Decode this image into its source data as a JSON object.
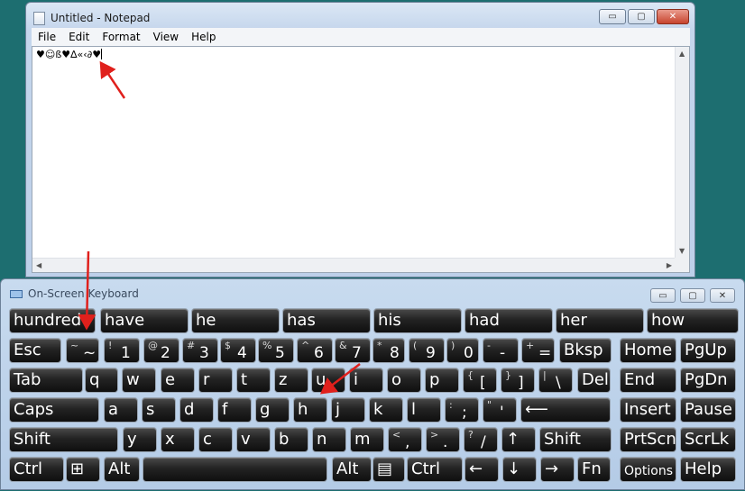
{
  "notepad": {
    "title": "Untitled - Notepad",
    "controls": {
      "minimize": "▭",
      "maximize": "▢",
      "close": "✕"
    },
    "menu": [
      "File",
      "Edit",
      "Format",
      "View",
      "Help"
    ],
    "content": "♥☺ß♥∆«‹∂♥"
  },
  "osk": {
    "title": "On-Screen Keyboard",
    "controls": {
      "minimize": "▭",
      "maximize": "▢",
      "close": "✕"
    },
    "predictions": [
      "hundred",
      "have",
      "he",
      "has",
      "his",
      "had",
      "her",
      "how"
    ],
    "rows": {
      "r1": [
        {
          "main": "Esc"
        },
        {
          "shift": "~",
          "base": "~"
        },
        {
          "shift": "!",
          "base": "1"
        },
        {
          "shift": "@",
          "base": "2"
        },
        {
          "shift": "#",
          "base": "3"
        },
        {
          "shift": "$",
          "base": "4"
        },
        {
          "shift": "%",
          "base": "5"
        },
        {
          "shift": "^",
          "base": "6"
        },
        {
          "shift": "&",
          "base": "7"
        },
        {
          "shift": "*",
          "base": "8"
        },
        {
          "shift": "(",
          "base": "9"
        },
        {
          "shift": ")",
          "base": "0"
        },
        {
          "shift": "-",
          "base": "-"
        },
        {
          "shift": "+",
          "base": "="
        },
        {
          "main": "Bksp"
        },
        {
          "main": "Home"
        },
        {
          "main": "PgUp"
        }
      ],
      "r2": [
        {
          "main": "Tab"
        },
        {
          "main": "q"
        },
        {
          "main": "w"
        },
        {
          "main": "e"
        },
        {
          "main": "r"
        },
        {
          "main": "t"
        },
        {
          "main": "z"
        },
        {
          "main": "u"
        },
        {
          "main": "i"
        },
        {
          "main": "o"
        },
        {
          "main": "p"
        },
        {
          "shift": "{",
          "base": "["
        },
        {
          "shift": "}",
          "base": "]"
        },
        {
          "shift": "|",
          "base": "\\"
        },
        {
          "main": "Del"
        },
        {
          "main": "End"
        },
        {
          "main": "PgDn"
        }
      ],
      "r3": [
        {
          "main": "Caps"
        },
        {
          "main": "a"
        },
        {
          "main": "s"
        },
        {
          "main": "d"
        },
        {
          "main": "f"
        },
        {
          "main": "g"
        },
        {
          "main": "h"
        },
        {
          "main": "j"
        },
        {
          "main": "k"
        },
        {
          "main": "l"
        },
        {
          "shift": ":",
          "base": ";"
        },
        {
          "shift": "\"",
          "base": "'"
        },
        {
          "main": "⟵"
        },
        {
          "main": "Insert"
        },
        {
          "main": "Pause"
        }
      ],
      "r4": [
        {
          "main": "Shift"
        },
        {
          "main": "y"
        },
        {
          "main": "x"
        },
        {
          "main": "c"
        },
        {
          "main": "v"
        },
        {
          "main": "b"
        },
        {
          "main": "n"
        },
        {
          "main": "m"
        },
        {
          "shift": "<",
          "base": ","
        },
        {
          "shift": ">",
          "base": "."
        },
        {
          "shift": "?",
          "base": "/"
        },
        {
          "main": "↑"
        },
        {
          "main": "Shift"
        },
        {
          "main": "PrtScn"
        },
        {
          "main": "ScrLk"
        }
      ],
      "r5": [
        {
          "main": "Ctrl"
        },
        {
          "main": "⊞"
        },
        {
          "main": "Alt"
        },
        {
          "main": ""
        },
        {
          "main": "Alt"
        },
        {
          "main": "▤"
        },
        {
          "main": "Ctrl"
        },
        {
          "main": "←"
        },
        {
          "main": "↓"
        },
        {
          "main": "→"
        },
        {
          "main": "Fn"
        },
        {
          "main": "Options"
        },
        {
          "main": "Help"
        }
      ]
    }
  },
  "annotation_color": "#e0201c"
}
